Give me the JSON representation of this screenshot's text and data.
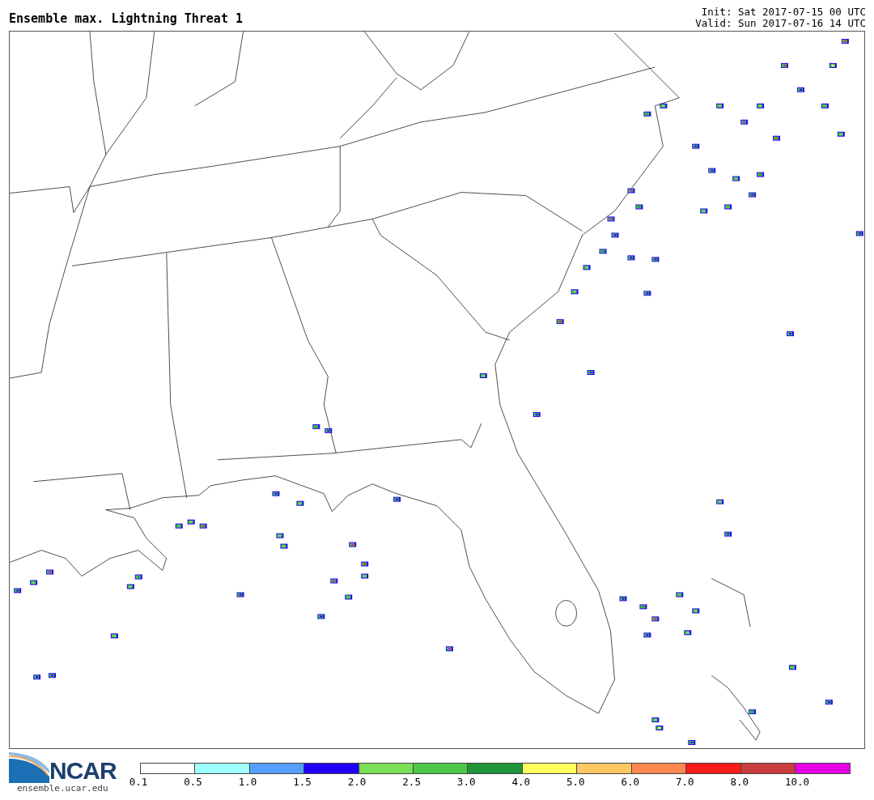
{
  "title": "Ensemble max. Lightning Threat 1",
  "init": "Init: Sat 2017-07-15 00 UTC",
  "valid": "Valid: Sun 2017-07-16 14 UTC",
  "logo": {
    "name": "NCAR",
    "url": "ensemble.ucar.edu"
  },
  "colorbar": {
    "bins": [
      {
        "color": "#ffffff",
        "label": "0.1"
      },
      {
        "color": "#a0ffff",
        "label": "0.5"
      },
      {
        "color": "#55a0ff",
        "label": "1.0"
      },
      {
        "color": "#2000ff",
        "label": "1.5"
      },
      {
        "color": "#7ae05a",
        "label": "2.0"
      },
      {
        "color": "#4cc944",
        "label": "2.5"
      },
      {
        "color": "#1f963a",
        "label": "3.0"
      },
      {
        "color": "#ffff60",
        "label": "4.0"
      },
      {
        "color": "#ffc864",
        "label": "5.0"
      },
      {
        "color": "#ff8850",
        "label": "6.0"
      },
      {
        "color": "#ff1a1a",
        "label": "7.0"
      },
      {
        "color": "#c83c3c",
        "label": "8.0"
      },
      {
        "color": "#e600e6",
        "label": "10.0"
      }
    ]
  }
}
